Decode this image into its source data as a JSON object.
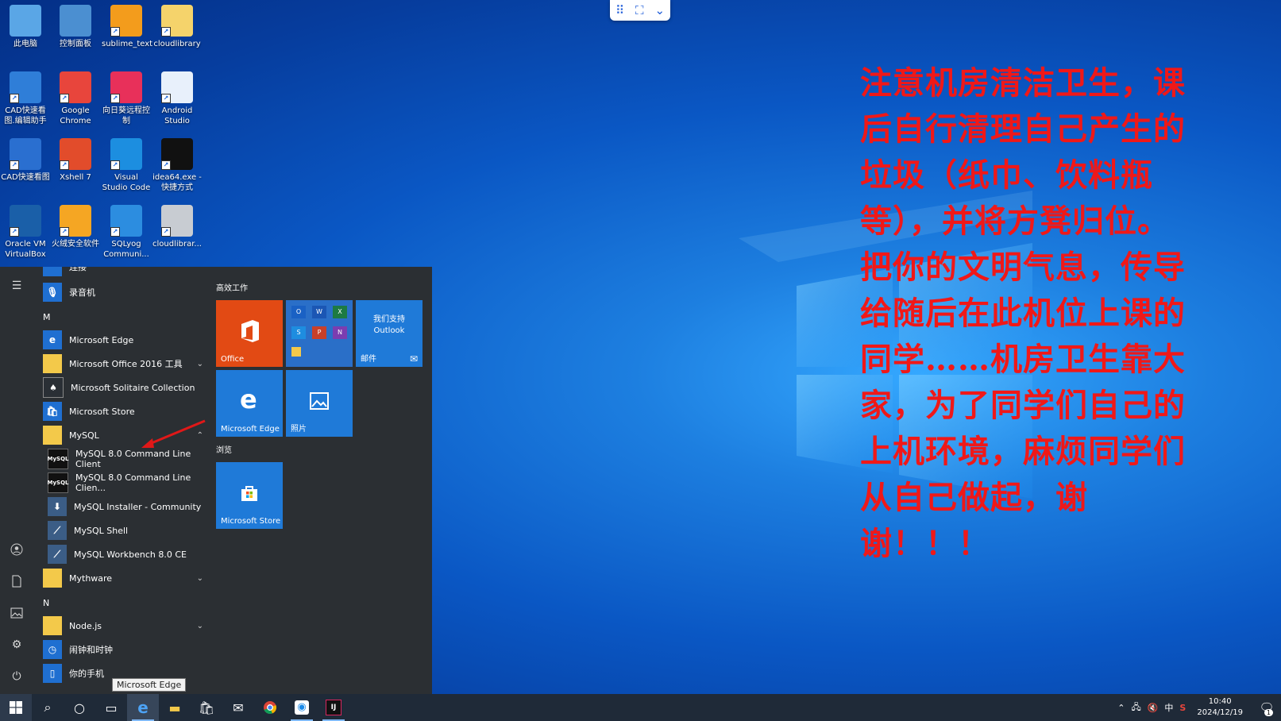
{
  "desktop": {
    "icons": [
      {
        "label": "此电脑",
        "icon": "computer-icon",
        "color": "#5aa6e6"
      },
      {
        "label": "控制面板",
        "icon": "control-panel-icon",
        "color": "#4b8fd1"
      },
      {
        "label": "sublime_text",
        "icon": "sublime-icon",
        "color": "#f39c1c"
      },
      {
        "label": "cloudlibrary",
        "icon": "folder-icon",
        "color": "#f5d36b"
      },
      {
        "label": "CAD快速看图.编辑助手",
        "icon": "cad-assistant-icon",
        "color": "#2f7ed8"
      },
      {
        "label": "Google Chrome",
        "icon": "chrome-icon",
        "color": "#e8453c"
      },
      {
        "label": "向日葵远程控制",
        "icon": "sunlogin-icon",
        "color": "#e8305a"
      },
      {
        "label": "Android Studio",
        "icon": "android-studio-icon",
        "color": "#e8f0fb"
      },
      {
        "label": "CAD快速看图",
        "icon": "cad-icon",
        "color": "#2a6fd0"
      },
      {
        "label": "Xshell 7",
        "icon": "xshell-icon",
        "color": "#e24c2b"
      },
      {
        "label": "Visual Studio Code",
        "icon": "vscode-icon",
        "color": "#1c8ee0"
      },
      {
        "label": "idea64.exe - 快捷方式",
        "icon": "intellij-icon",
        "color": "#111111"
      },
      {
        "label": "Oracle VM VirtualBox",
        "icon": "virtualbox-icon",
        "color": "#1a5fa8"
      },
      {
        "label": "火绒安全软件",
        "icon": "huorong-icon",
        "color": "#f5a623"
      },
      {
        "label": "SQLyog Communi...",
        "icon": "sqlyog-icon",
        "color": "#2c8de0"
      },
      {
        "label": "cloudlibrar...",
        "icon": "file-icon",
        "color": "#c8ccd2"
      }
    ]
  },
  "remote_bar": {
    "grid": "⠿",
    "fullscreen": "⛶",
    "chevron": "⌄"
  },
  "notice": {
    "text": "注意机房清洁卫生，课后自行清理自己产生的垃圾（纸巾、饮料瓶等），并将方凳归位。把你的文明气息，传导给随后在此机位上课的同学……机房卫生靠大家，为了同学们自己的上机环境，麻烦同学们从自己做起，谢谢！！！",
    "color": "#f01818"
  },
  "start_menu": {
    "rail": [
      "menu-icon",
      "user-icon",
      "document-icon",
      "pictures-icon",
      "settings-icon",
      "power-icon"
    ],
    "list": {
      "partial_top": "连接",
      "recorder": "录音机",
      "letter_m": "M",
      "edge": "Microsoft Edge",
      "office_tools": "Microsoft Office 2016 工具",
      "solitaire": "Microsoft Solitaire Collection",
      "store": "Microsoft Store",
      "mysql": "MySQL",
      "mysql_children": [
        "MySQL 8.0 Command Line Client",
        "MySQL 8.0 Command Line Clien...",
        "MySQL Installer - Community",
        "MySQL Shell",
        "MySQL Workbench 8.0 CE"
      ],
      "mythware": "Mythware",
      "letter_n": "N",
      "nodejs": "Node.js",
      "alarms": "闹钟和时钟",
      "your_phone": "你的手机"
    },
    "tiles": {
      "group1": "高效工作",
      "office": "Office",
      "outlook_line1": "我们支持",
      "outlook_line2": "Outlook",
      "mail": "邮件",
      "edge": "Microsoft Edge",
      "photos": "照片",
      "group2": "浏览",
      "store": "Microsoft Store"
    }
  },
  "tooltip": "Microsoft Edge",
  "taskbar": {
    "tray_ime": "中",
    "time": "10:40",
    "date": "2024/12/19",
    "notification_count": "1"
  }
}
